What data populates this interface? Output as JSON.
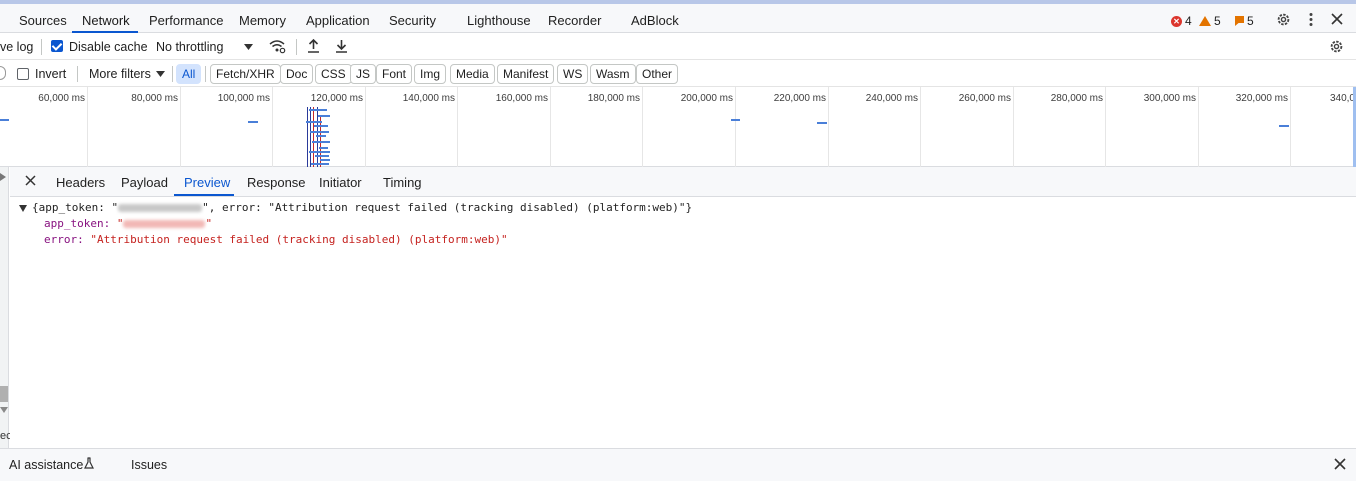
{
  "top_tabs": [
    "Sources",
    "Network",
    "Performance",
    "Memory",
    "Application",
    "Security",
    "Lighthouse",
    "Recorder",
    "AdBlock"
  ],
  "active_tab": "Network",
  "status": {
    "errors": "4",
    "warnings": "5",
    "info": "5"
  },
  "toolbar": {
    "preserve_log": "ve log",
    "disable_cache": "Disable cache",
    "throttling": "No throttling"
  },
  "filters": {
    "invert": "Invert",
    "more_filters": "More filters",
    "types": [
      "All",
      "Fetch/XHR",
      "Doc",
      "CSS",
      "JS",
      "Font",
      "Img",
      "Media",
      "Manifest",
      "WS",
      "Wasm",
      "Other"
    ],
    "selected": "All"
  },
  "timeline": {
    "ticks": [
      "60,000 ms",
      "80,000 ms",
      "100,000 ms",
      "120,000 ms",
      "140,000 ms",
      "160,000 ms",
      "180,000 ms",
      "200,000 ms",
      "220,000 ms",
      "240,000 ms",
      "260,000 ms",
      "280,000 ms",
      "300,000 ms",
      "320,000 ms",
      "340,0"
    ]
  },
  "detail": {
    "tabs": [
      "Headers",
      "Payload",
      "Preview",
      "Response",
      "Initiator",
      "Timing"
    ],
    "active": "Preview",
    "preview": {
      "summary_prefix": "{app_token: \"",
      "summary_suffix": "\", error: \"Attribution request failed (tracking disabled) (platform:web)\"}",
      "app_token_key": "app_token: ",
      "app_token_quote": "\"",
      "error_key": "error: ",
      "error_value": "\"Attribution request failed (tracking disabled) (platform:web)\""
    }
  },
  "left_strip_text": "ec",
  "drawer": {
    "tabs": [
      "AI assistance",
      "Issues"
    ]
  },
  "colors": {
    "accent": "#0b57d0",
    "error_text": "#c5221f",
    "key_text": "#881280"
  }
}
